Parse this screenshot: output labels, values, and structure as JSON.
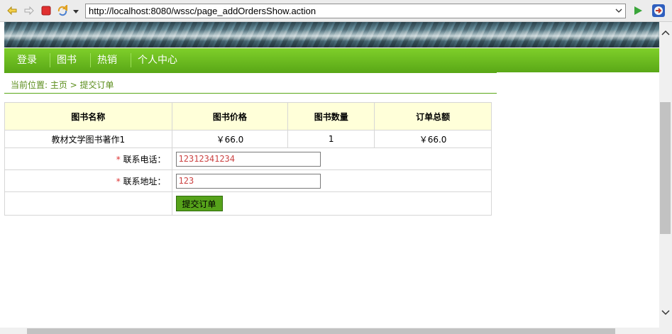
{
  "browser": {
    "url": "http://localhost:8080/wssc/page_addOrdersShow.action",
    "icons": [
      "back-arrow-icon",
      "forward-arrow-icon",
      "stop-icon",
      "refresh-icon",
      "dropdown-icon",
      "go-icon",
      "extension-icon"
    ]
  },
  "nav": {
    "items": [
      "登录",
      "图书",
      "热销",
      "个人中心"
    ]
  },
  "breadcrumb": {
    "text": "当前位置: 主页 > 提交订单"
  },
  "order": {
    "headers": [
      "图书名称",
      "图书价格",
      "图书数量",
      "订单总额"
    ],
    "row": {
      "name": "教材文学图书著作1",
      "price": "￥66.0",
      "quantity": "1",
      "total": "￥66.0"
    },
    "phone_label": "联系电话：",
    "phone_value": "12312341234",
    "address_label": "联系地址：",
    "address_value": "123",
    "required_mark": "*",
    "submit_label": "提交订单"
  },
  "colors": {
    "nav_green": "#5aa817",
    "header_bg": "#ffffd9",
    "crumb_text": "#5b8d1b"
  }
}
